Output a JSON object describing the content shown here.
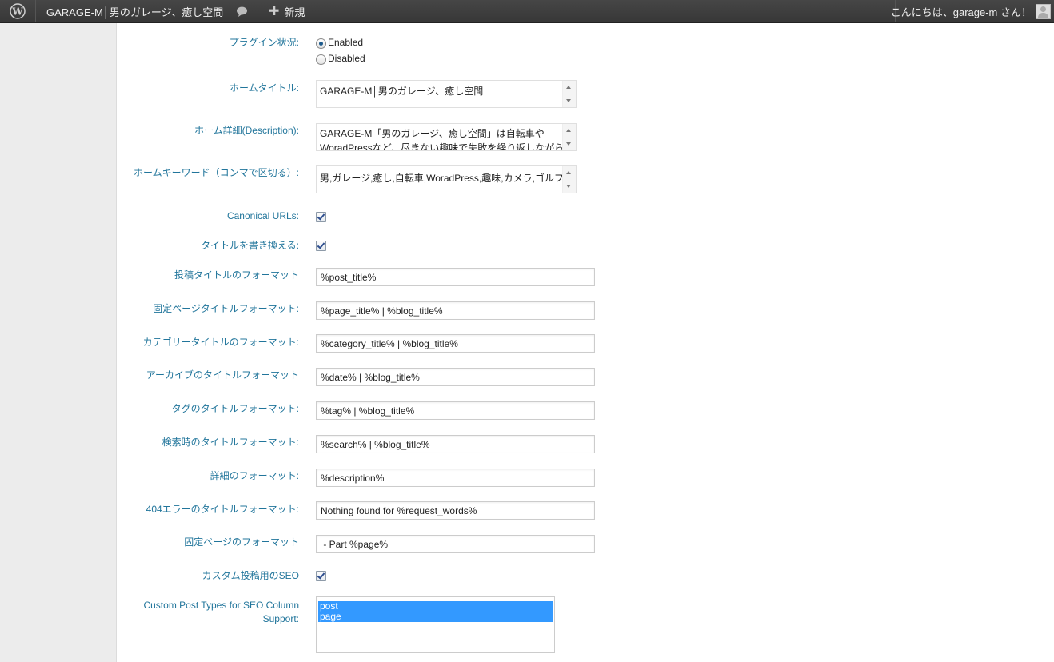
{
  "admin_bar": {
    "site_name": "GARAGE-M│男のガレージ、癒し空間",
    "new_label": "新規",
    "greeting": "こんにちは、garage-m さん！",
    "icons": {
      "logo": "wordpress-icon",
      "comments": "comment-bubble-icon",
      "add": "plus-icon",
      "user": "avatar-icon"
    }
  },
  "form": {
    "plugin_status": {
      "label": "プラグイン状況:",
      "options": [
        "Enabled",
        "Disabled"
      ],
      "selected": "Enabled"
    },
    "home_title": {
      "label": "ホームタイトル:",
      "value": "GARAGE-M│男のガレージ、癒し空間"
    },
    "home_description": {
      "label": "ホーム詳細(Description):",
      "value_line1": "GARAGE-M「男のガレージ、癒し空間」は自転車や",
      "value_line2": "WoradPressなど、尽きない趣味で失敗を繰り返しながらも"
    },
    "home_keywords": {
      "label": "ホームキーワード（コンマで区切る）:",
      "value": "男,ガレージ,癒し,自転車,WoradPress,趣味,カメラ,ゴルフ"
    },
    "canonical_urls": {
      "label": "Canonical URLs:",
      "checked": true
    },
    "rewrite_titles": {
      "label": "タイトルを書き換える:",
      "checked": true
    },
    "post_title_format": {
      "label": "投稿タイトルのフォーマット",
      "value": "%post_title%"
    },
    "page_title_format": {
      "label": "固定ページタイトルフォーマット:",
      "value": "%page_title% | %blog_title%"
    },
    "category_title_format": {
      "label": "カテゴリータイトルのフォーマット:",
      "value": "%category_title% | %blog_title%"
    },
    "archive_title_format": {
      "label": "アーカイブのタイトルフォーマット",
      "value": "%date% | %blog_title%"
    },
    "tag_title_format": {
      "label": "タグのタイトルフォーマット:",
      "value": "%tag% | %blog_title%"
    },
    "search_title_format": {
      "label": "検索時のタイトルフォーマット:",
      "value": "%search% | %blog_title%"
    },
    "description_format": {
      "label": "詳細のフォーマット:",
      "value": "%description%"
    },
    "404_title_format": {
      "label": "404エラーのタイトルフォーマット:",
      "value": "Nothing found for %request_words%"
    },
    "paged_format": {
      "label": "固定ページのフォーマット",
      "value": " - Part %page%"
    },
    "custom_post_seo": {
      "label": "カスタム投稿用のSEO",
      "checked": true
    },
    "cpt_column_support": {
      "label_line1": "Custom Post Types for SEO Column",
      "label_line2": "Support:",
      "options": [
        "post",
        "page"
      ],
      "selected": [
        "post",
        "page"
      ]
    }
  },
  "colors": {
    "label": "#21759b",
    "admin_bar": "#464646",
    "selection": "#3399ff"
  }
}
